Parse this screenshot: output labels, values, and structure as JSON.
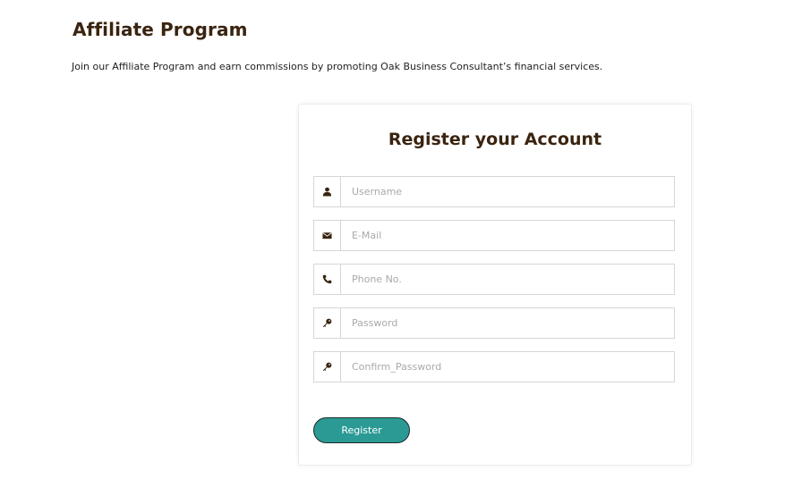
{
  "page": {
    "title": "Affiliate Program",
    "intro": "Join our Affiliate Program and earn commissions by promoting Oak Business Consultant’s financial services."
  },
  "form": {
    "title": "Register your Account",
    "fields": [
      {
        "placeholder": "Username",
        "icon": "user-icon"
      },
      {
        "placeholder": "E-Mail",
        "icon": "envelope-icon"
      },
      {
        "placeholder": "Phone No.",
        "icon": "phone-icon"
      },
      {
        "placeholder": "Password",
        "icon": "key-icon"
      },
      {
        "placeholder": "Confirm_Password",
        "icon": "key-icon"
      }
    ],
    "submit_label": "Register"
  },
  "colors": {
    "heading": "#3a2410",
    "button": "#2b9a94",
    "border": "#d6d6d6"
  }
}
